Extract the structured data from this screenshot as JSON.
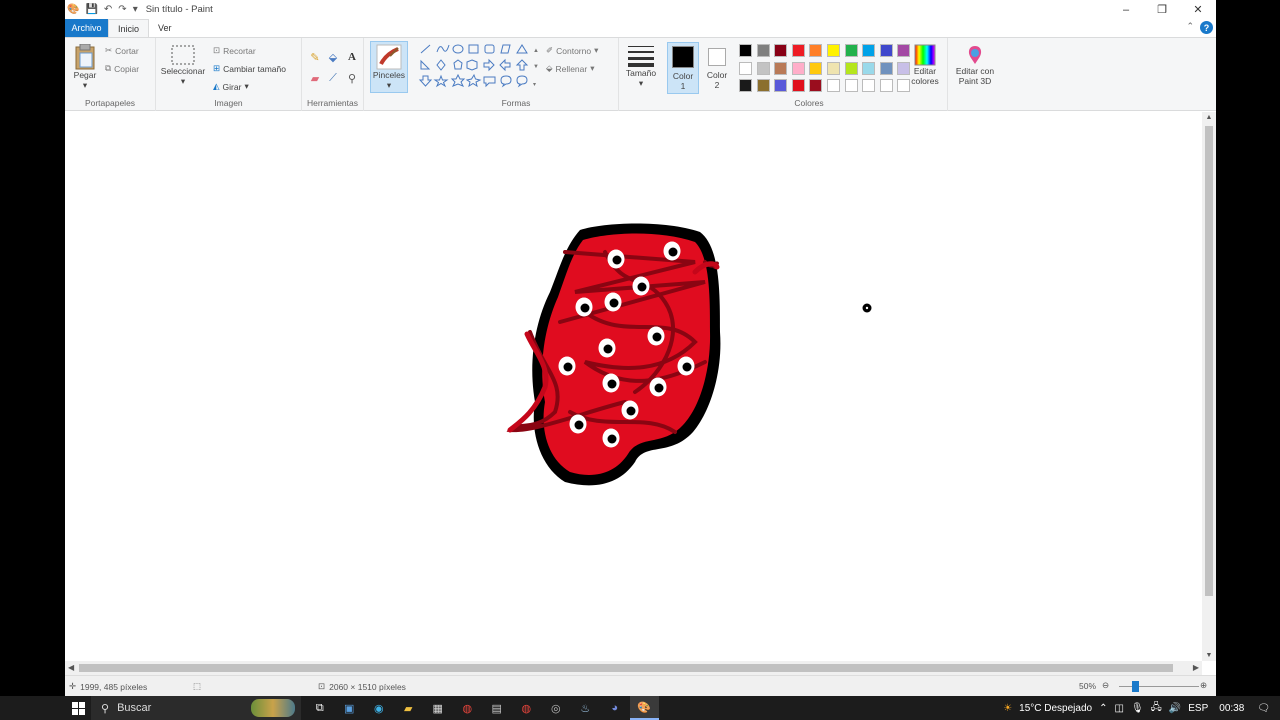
{
  "window": {
    "title": "Sin título - Paint",
    "controls": [
      "–",
      "❐",
      "✕"
    ]
  },
  "tabs": {
    "file": "Archivo",
    "home": "Inicio",
    "view": "Ver"
  },
  "ribbon": {
    "clipboard": {
      "label": "Portapapeles",
      "paste": "Pegar",
      "cut": "Cortar",
      "copy": "Copiar"
    },
    "image": {
      "label": "Imagen",
      "select": "Seleccionar",
      "crop": "Recortar",
      "resize": "Cambiar tamaño",
      "rotate": "Girar"
    },
    "tools": {
      "label": "Herramientas"
    },
    "brushes": {
      "label": "Pinceles"
    },
    "shapes": {
      "label": "Formas",
      "outline": "Contorno",
      "fill": "Rellenar"
    },
    "size": {
      "label": "Tamaño"
    },
    "colors": {
      "label": "Colores",
      "color1": "Color 1",
      "color2": "Color 2",
      "edit": "Editar colores",
      "paint3d": "Editar con Paint 3D",
      "color1_value": "#000000",
      "color2_value": "#ffffff",
      "palette": [
        "#000000",
        "#7f7f7f",
        "#880015",
        "#ed1c24",
        "#ff7f27",
        "#fff200",
        "#22b14c",
        "#00a2e8",
        "#3f48cc",
        "#a349a4",
        "#ffffff",
        "#c3c3c3",
        "#b97a57",
        "#ffaec9",
        "#ffc90e",
        "#efe4b0",
        "#b5e61d",
        "#99d9ea",
        "#7092be",
        "#c8bfe7",
        "#1a1a1a",
        "#8b6f2e",
        "#5959d9",
        "#e0101c",
        "#9a0d1e",
        "#ffffff",
        "#ffffff",
        "#ffffff",
        "#ffffff",
        "#ffffff"
      ]
    }
  },
  "status": {
    "cursor": "1999, 485 píxeles",
    "size": "2060 × 1510 píxeles",
    "zoom": "50%",
    "zoom_level": 0.5
  },
  "taskbar": {
    "search": "Buscar",
    "weather": "15°C  Despejado",
    "lang": "ESP",
    "time": "00:38",
    "apps": [
      "task-view",
      "app-1",
      "edge",
      "explorer",
      "store",
      "chrome",
      "calculator",
      "chrome-2",
      "app-2",
      "steam",
      "discord",
      "paint"
    ]
  }
}
